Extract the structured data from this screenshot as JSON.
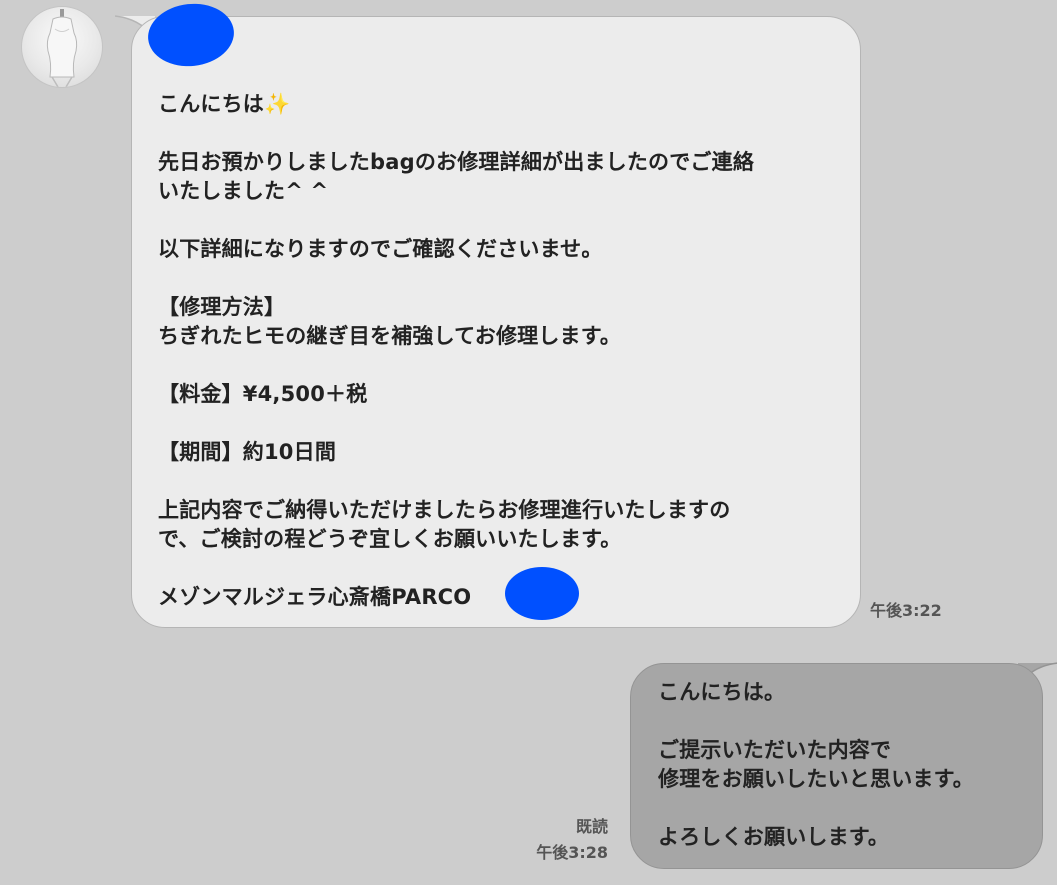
{
  "contact": {
    "avatar_icon": "mannequin-icon"
  },
  "incoming_message": {
    "lines": [
      "こんにちは✨",
      "",
      "先日お預かりしましたbagのお修理詳細が出ましたのでご連絡",
      "いたしました^ ^",
      "",
      "以下詳細になりますのでご確認くださいませ。",
      "",
      "【修理方法】",
      "ちぎれたヒモの継ぎ目を補強してお修理します。",
      "",
      "【料金】¥4,500＋税",
      "",
      "【期間】約10日間",
      "",
      "上記内容でご納得いただけましたらお修理進行いたしますの",
      "で、ご検討の程どうぞ宜しくお願いいたします。",
      "",
      "メゾンマルジェラ心斎橋PARCO"
    ],
    "time": "午後3:22",
    "bubble_color": "#ececec"
  },
  "outgoing_message": {
    "lines": [
      "こんにちは。",
      "",
      "ご提示いただいた内容で",
      "修理をお願いしたいと思います。",
      "",
      "よろしくお願いします。"
    ],
    "read_label": "既読",
    "time": "午後3:28",
    "bubble_color": "#a6a6a6"
  },
  "colors": {
    "background": "#cdcdcd",
    "redaction": "#0050ff",
    "meta_text": "#555555"
  }
}
